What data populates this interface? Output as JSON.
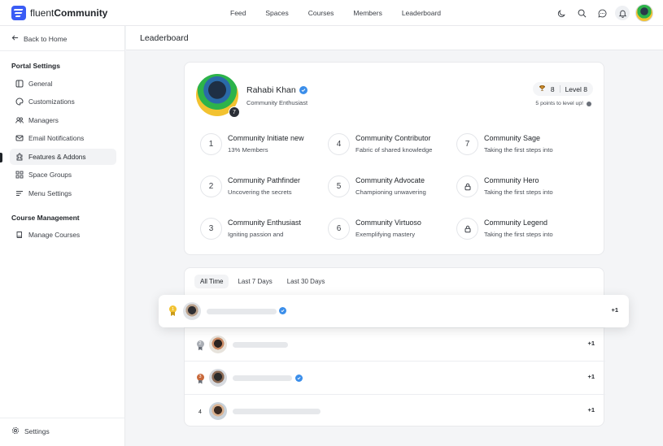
{
  "app": {
    "brand_light": "fluent",
    "brand_bold": "Community",
    "accent": "#3a5cf5"
  },
  "topnav": [
    {
      "label": "Feed"
    },
    {
      "label": "Spaces"
    },
    {
      "label": "Courses"
    },
    {
      "label": "Members"
    },
    {
      "label": "Leaderboard"
    }
  ],
  "top_icons": [
    "moon-icon",
    "search-icon",
    "chat-icon",
    "bell-icon"
  ],
  "sidebar": {
    "back": "Back to Home",
    "portal_title": "Portal Settings",
    "portal_items": [
      {
        "label": "General",
        "icon": "grid-icon"
      },
      {
        "label": "Customizations",
        "icon": "palette-icon"
      },
      {
        "label": "Managers",
        "icon": "users-icon"
      },
      {
        "label": "Email Notifications",
        "icon": "mail-icon"
      },
      {
        "label": "Features & Addons",
        "icon": "puzzle-icon",
        "active": true
      },
      {
        "label": "Space Groups",
        "icon": "squares-icon"
      },
      {
        "label": "Menu Settings",
        "icon": "menu-icon"
      }
    ],
    "course_title": "Course Management",
    "course_items": [
      {
        "label": "Manage Courses",
        "icon": "book-icon"
      }
    ],
    "settings": "Settings"
  },
  "page": {
    "title": "Leaderboard"
  },
  "profile": {
    "name": "Rahabi Khan",
    "role": "Community Enthusiast",
    "level_badge": "7",
    "points": "8",
    "level": "Level 8",
    "levelup": "5 points to level up!"
  },
  "badges": [
    {
      "num": "1",
      "title": "Community Initiate new",
      "sub": "13% Members"
    },
    {
      "num": "4",
      "title": "Community Contributor",
      "sub": "Fabric of shared knowledge"
    },
    {
      "num": "7",
      "title": "Community Sage",
      "sub": "Taking the first steps into"
    },
    {
      "num": "2",
      "title": "Community Pathfinder",
      "sub": "Uncovering the secrets"
    },
    {
      "num": "5",
      "title": "Community Advocate",
      "sub": "Championing unwavering"
    },
    {
      "num": "",
      "title": "Community Hero",
      "sub": "Taking the first steps into",
      "locked": true
    },
    {
      "num": "3",
      "title": "Community Enthusiast",
      "sub": "Igniting passion and"
    },
    {
      "num": "6",
      "title": "Community Virtuoso",
      "sub": "Exemplifying mastery"
    },
    {
      "num": "",
      "title": "Community Legend",
      "sub": "Taking the first steps into",
      "locked": true
    }
  ],
  "leaderboard": {
    "tabs": [
      {
        "label": "All Time",
        "active": true
      },
      {
        "label": "Last 7 Days"
      },
      {
        "label": "Last 30 Days"
      }
    ],
    "rows": [
      {
        "rank": "1",
        "points": "+1",
        "verified": true,
        "medal_color": "#f2c230"
      },
      {
        "rank": "2",
        "points": "+1",
        "verified": false,
        "medal_color": "#a9adb4"
      },
      {
        "rank": "3",
        "points": "+1",
        "verified": true,
        "medal_color": "#c8683a"
      },
      {
        "rank": "4",
        "points": "+1",
        "verified": false
      }
    ]
  }
}
